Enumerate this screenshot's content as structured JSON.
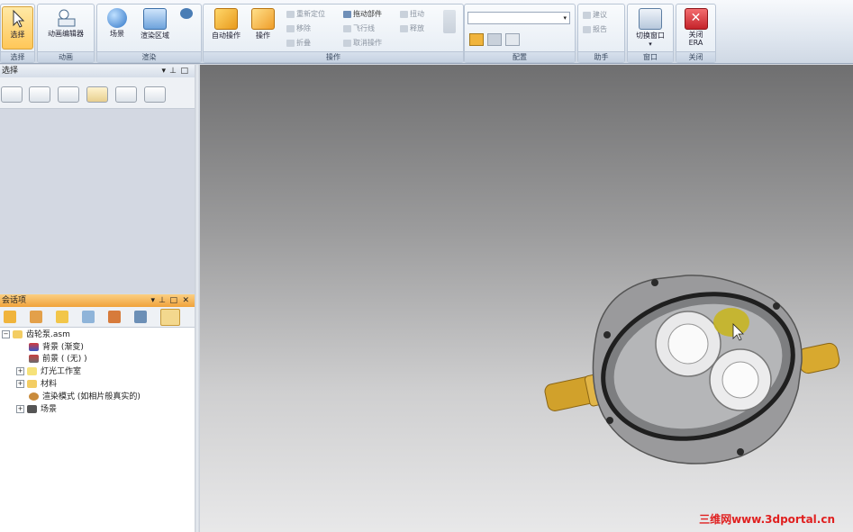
{
  "ribbon": {
    "groups": {
      "select": {
        "label": "选择",
        "buttons": {
          "select": "选择"
        }
      },
      "animation": {
        "label": "动画",
        "buttons": {
          "animation_editor": "动画编辑器"
        }
      },
      "render": {
        "label": "渲染",
        "buttons": {
          "scene": "场景",
          "render_region": "渲染区域"
        }
      },
      "operate": {
        "label": "操作",
        "buttons": {
          "auto_operate": "自动操作",
          "operate": "操作"
        },
        "small": {
          "reposition": "重新定位",
          "drag_part": "拖动部件",
          "explode": "扭动",
          "move": "移除",
          "fly_line": "飞行线",
          "release": "释放",
          "fold": "折叠",
          "cancel_op": "取消操作"
        }
      },
      "config": {
        "label": "配置",
        "dropdown_value": ""
      },
      "assistant": {
        "label": "助手",
        "small": {
          "build": "建议",
          "report": "报告"
        }
      },
      "window": {
        "label": "窗口",
        "buttons": {
          "switch_window": "切换窗口"
        }
      },
      "close": {
        "label": "关闭",
        "buttons": {
          "close_era": "关闭\nERA"
        }
      }
    }
  },
  "select_pane": {
    "title": "选择"
  },
  "session_pane": {
    "title": "会话项",
    "tree": [
      {
        "label": "齿轮泵.asm",
        "icon": "folder-icon"
      },
      {
        "label": "背景 (渐变)",
        "icon": "background-icon"
      },
      {
        "label": "前景 ( (无) )",
        "icon": "foreground-icon"
      },
      {
        "label": "灯光工作室",
        "icon": "light-icon"
      },
      {
        "label": "材料",
        "icon": "folder-icon"
      },
      {
        "label": "渲染模式 (如相片般真实的)",
        "icon": "render-mode-icon"
      },
      {
        "label": "场景",
        "icon": "scene-icon"
      }
    ]
  },
  "watermark": "三维网www.3dportal.cn",
  "colors": {
    "accent": "#ffc758",
    "pane_header": "#f6b24a",
    "close": "#d9343a"
  }
}
